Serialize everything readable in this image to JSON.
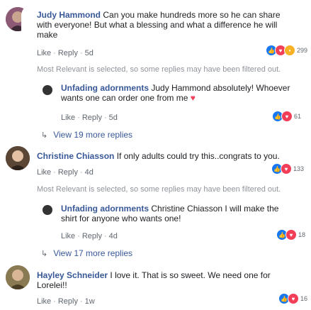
{
  "comments": [
    {
      "author": "Judy Hammond",
      "text_lines": [
        "Can you make hundreds more so he can share",
        "with everyone! But what a blessing and what a difference he will",
        "make"
      ],
      "like": "Like",
      "reply": "Reply",
      "time": "5d",
      "reaction_count": "299",
      "reactions": [
        "like-icon",
        "love-icon",
        "wow-icon"
      ]
    },
    {
      "author": "Christine Chiasson",
      "text": "If only adults could try this..congrats to you.",
      "like": "Like",
      "reply": "Reply",
      "time": "4d",
      "reaction_count": "133",
      "reactions": [
        "like-icon",
        "love-icon"
      ]
    },
    {
      "author": "Hayley Schneider",
      "text_lines": [
        "I love it. That is so sweet. We need one for",
        "Lorelei!!"
      ],
      "like": "Like",
      "reply": "Reply",
      "time": "1w",
      "reaction_count": "16",
      "reactions": [
        "like-icon",
        "love-icon"
      ]
    }
  ],
  "replies": [
    {
      "author": "Unfading adornments",
      "text_lines": [
        "Judy Hammond absolutely! Whoever",
        "wants one can order one from me"
      ],
      "emoji": "heart-icon",
      "like": "Like",
      "reply": "Reply",
      "time": "5d",
      "reaction_count": "61",
      "reactions": [
        "like-icon",
        "love-icon"
      ]
    },
    {
      "author": "Unfading adornments",
      "text_lines": [
        "Christine Chiasson I will make the",
        "shirt for anyone who wants one!"
      ],
      "like": "Like",
      "reply": "Reply",
      "time": "4d",
      "reaction_count": "18",
      "reactions": [
        "like-icon",
        "love-icon"
      ]
    }
  ],
  "notice": "Most Relevant is selected, so some replies may have been filtered out.",
  "view_more": [
    "View 19 more replies",
    "View 17 more replies"
  ],
  "colors": {
    "link": "#385898",
    "bubble": "#f2f3f5",
    "like": "#1877f2",
    "love": "#f33e58",
    "wow": "#f7b125"
  }
}
